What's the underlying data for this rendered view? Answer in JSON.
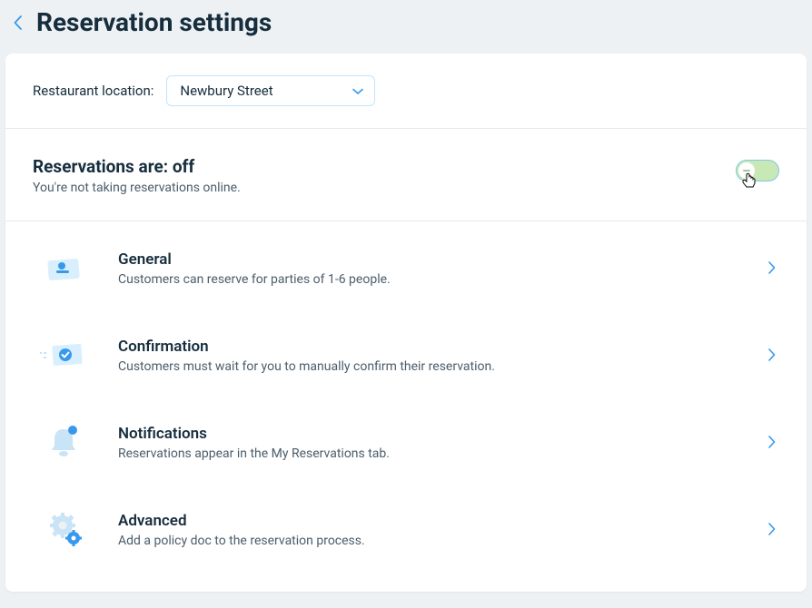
{
  "header": {
    "title": "Reservation settings"
  },
  "location": {
    "label": "Restaurant location:",
    "selected": "Newbury Street"
  },
  "status": {
    "title": "Reservations are: off",
    "subtitle": "You're not taking reservations online."
  },
  "settings": [
    {
      "key": "general",
      "title": "General",
      "desc": "Customers can reserve for parties of 1-6 people."
    },
    {
      "key": "confirmation",
      "title": "Confirmation",
      "desc": "Customers must wait for you to manually confirm their reservation."
    },
    {
      "key": "notifications",
      "title": "Notifications",
      "desc": "Reservations appear in the My Reservations tab."
    },
    {
      "key": "advanced",
      "title": "Advanced",
      "desc": "Add a policy doc to the reservation process."
    }
  ]
}
